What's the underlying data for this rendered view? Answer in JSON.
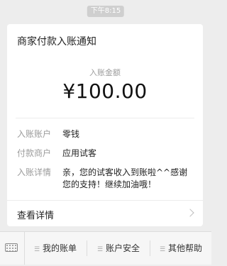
{
  "chat": {
    "timestamp": "下午8:15"
  },
  "card": {
    "title": "商家付款入账通知",
    "amount_label": "入账金额",
    "amount": "¥100.00",
    "rows": [
      {
        "label": "入账账户",
        "value": "零钱"
      },
      {
        "label": "付款商户",
        "value": "应用试客"
      },
      {
        "label": "入账详情",
        "value": "亲，您的试客收入到账啦^^感谢您的支持！继续加油哦！"
      }
    ],
    "view_details": "查看详情"
  },
  "menu": {
    "items": [
      {
        "label": "我的账单",
        "icon": "hamburger-icon"
      },
      {
        "label": "账户安全",
        "icon": "hamburger-icon"
      },
      {
        "label": "其他帮助",
        "icon": "hamburger-icon"
      }
    ],
    "keyboard_icon": "keyboard-icon"
  }
}
